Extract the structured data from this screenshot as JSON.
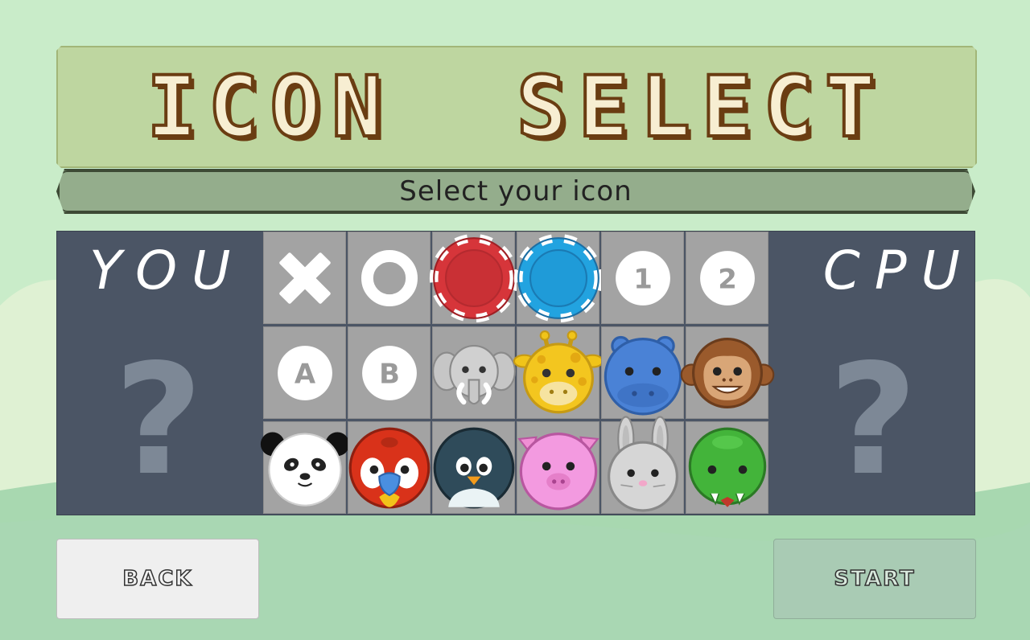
{
  "title": "ICON  SELECT",
  "subtitle": "Select your icon",
  "players": {
    "you_label": "YOU",
    "cpu_label": "CPU",
    "you_placeholder": "?",
    "cpu_placeholder": "?"
  },
  "icons": [
    [
      "x-mark-icon",
      "circle-mark-icon",
      "red-chip-icon",
      "blue-chip-icon",
      "number-one-icon",
      "number-two-icon"
    ],
    [
      "letter-a-icon",
      "letter-b-icon",
      "elephant-icon",
      "giraffe-icon",
      "hippo-icon",
      "monkey-icon"
    ],
    [
      "panda-icon",
      "parrot-icon",
      "penguin-icon",
      "pig-icon",
      "rabbit-icon",
      "crocodile-icon"
    ]
  ],
  "icon_text": {
    "number_one": "1",
    "number_two": "2",
    "letter_a": "A",
    "letter_b": "B"
  },
  "buttons": {
    "back": "BACK",
    "start": "START"
  },
  "colors": {
    "background": "#c9ecc9",
    "board": "#4b5565",
    "cell": "#a3a3a3",
    "title_fill": "#f7eed2",
    "title_outline": "#6a3d12",
    "start_disabled": "#a9cbb4"
  }
}
